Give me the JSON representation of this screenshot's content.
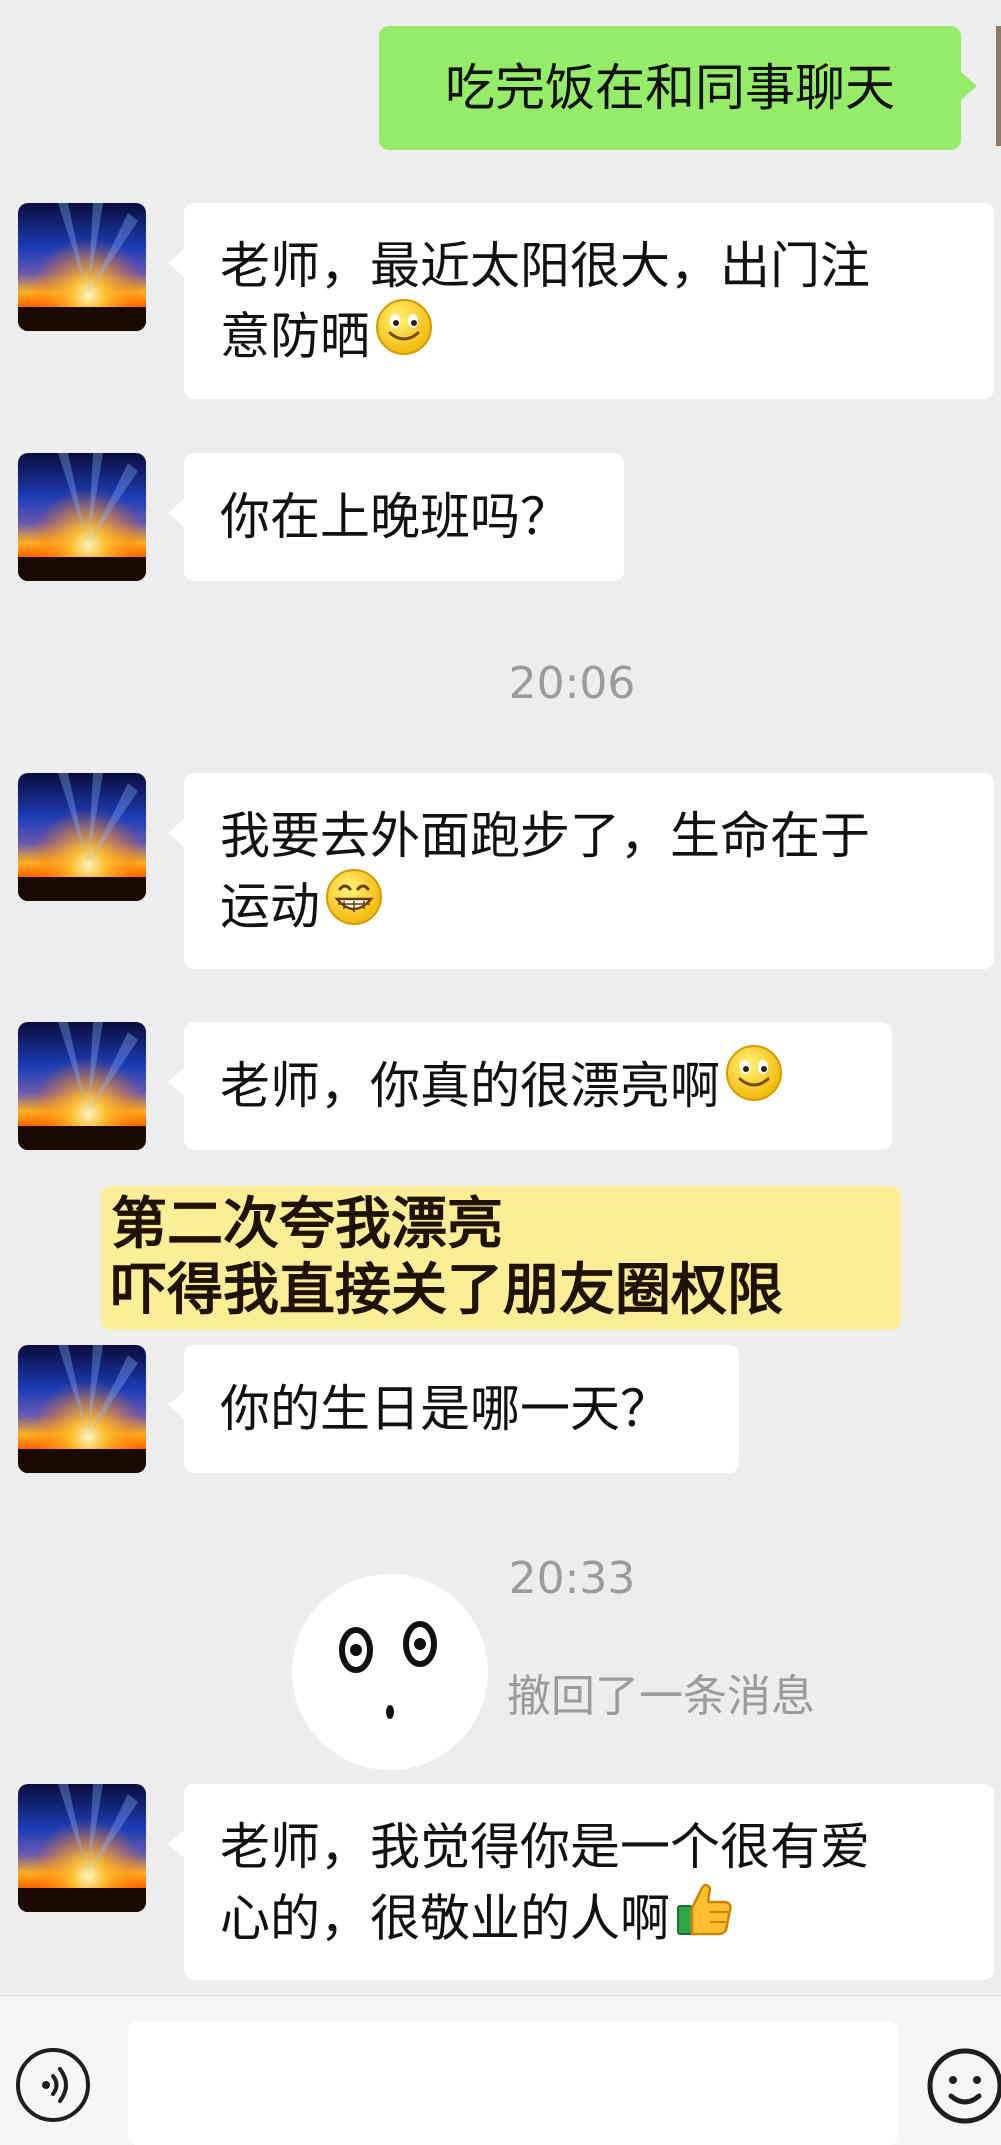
{
  "conversation": {
    "messages": [
      {
        "side": "right",
        "text": "吃完饭在和同事聊天",
        "emoji": ""
      },
      {
        "side": "left",
        "line1": "老师，最近太阳很大，出门注",
        "line2": "意防晒",
        "emoji": "smile-emoji-icon"
      },
      {
        "side": "left",
        "text": "你在上晚班吗？",
        "emoji": ""
      },
      {
        "side": "left",
        "line1": "我要去外面跑步了，生命在于",
        "line2": "运动",
        "emoji": "grin-emoji-icon"
      },
      {
        "side": "left",
        "text": "老师，你真的很漂亮啊",
        "emoji": "smile-emoji-icon"
      },
      {
        "side": "left",
        "text": "你的生日是哪一天？",
        "emoji": ""
      },
      {
        "side": "left",
        "line1": "老师，我觉得你是一个很有爱",
        "line2": "心的，很敬业的人啊",
        "emoji": "thumbs-up-emoji-icon"
      }
    ],
    "timestamps": [
      "20:06",
      "20:33"
    ],
    "recall_notice": "撤回了一条消息"
  },
  "annotation": {
    "line1": "第二次夸我漂亮",
    "line2": "吓得我直接关了朋友圈权限"
  },
  "colors": {
    "background": "#ededed",
    "sent_bubble": "#95ec69",
    "received_bubble": "#ffffff",
    "annotation_highlight": "#fbee96",
    "timestamp_text": "#9b9b9b"
  },
  "bottom_bar": {
    "voice_icon": "voice-icon",
    "emoji_icon": "emoji-face-icon"
  }
}
